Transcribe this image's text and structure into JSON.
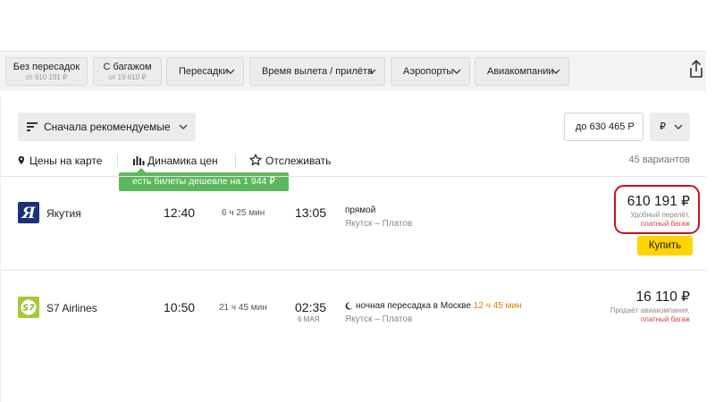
{
  "filters": [
    {
      "title": "Без пересадок",
      "subtitle": "от 610 191 ₽"
    },
    {
      "title": "С багажом",
      "subtitle": "от 19 610 ₽"
    }
  ],
  "dropdowns": [
    "Пересадки",
    "Время вылета / прилёта",
    "Аэропорты",
    "Авиакомпании"
  ],
  "share_icon": "share-icon",
  "sort": {
    "label": "Сначала рекомендуемые"
  },
  "max_price": {
    "value": "до 630 465 Р"
  },
  "currency": {
    "label": "₽"
  },
  "tools": {
    "map": "Цены на карте",
    "dynamics": "Динамика цен",
    "track": "Отслеживать"
  },
  "variants_count": "45 вариантов",
  "tooltip": "есть билеты дешевле на 1 944 ₽",
  "flights": [
    {
      "airline": "Якутия",
      "logo_letter": "Я",
      "logo_color": "#1c2f7a",
      "depart": "12:40",
      "duration": "6 ч 25 мин",
      "arrive": "13:05",
      "arrive_date": "",
      "stop_text": "прямой",
      "stop_highlight": "",
      "route": "Якутск – Платов",
      "price": "610 191 ₽",
      "note": "Удобный перелёт,",
      "baggage": "платный багаж",
      "buy_label": "Купить"
    },
    {
      "airline": "S7 Airlines",
      "logo_letter": "S7",
      "logo_color": "#a6c936",
      "depart": "10:50",
      "duration": "21 ч 45 мин",
      "arrive": "02:35",
      "arrive_date": "6 МАЯ",
      "stop_text": "ночная пересадка в Москве",
      "stop_highlight": "12 ч 45 мин",
      "route": "Якутск – Платов",
      "price": "16 110 ₽",
      "note": "Продаёт авиакомпания,",
      "baggage": "платный багаж",
      "buy_label": ""
    }
  ],
  "colors": {
    "buy_button": "#ffd400",
    "tooltip_bg": "#5cb85c",
    "highlight_ring": "#c8111b",
    "baggage_text": "#d64040",
    "stop_highlight": "#d98000"
  }
}
